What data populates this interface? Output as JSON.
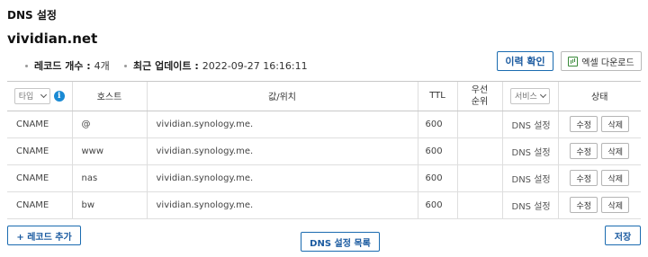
{
  "header": {
    "title": "DNS 설정"
  },
  "domain": {
    "name": "vividian.net"
  },
  "meta": {
    "record_count_label": "레코드 개수 :",
    "record_count_value": "4개",
    "updated_label": "최근 업데이트 :",
    "updated_value": "2022-09-27 16:16:11"
  },
  "actions": {
    "history_label": "이력 확인",
    "excel_label": "엑셀 다운로드"
  },
  "table": {
    "type_select": "타입",
    "info_icon": "i",
    "columns": {
      "host": "호스트",
      "value": "값/위치",
      "ttl": "TTL",
      "priority_line1": "우선",
      "priority_line2": "순위",
      "service_select": "서비스",
      "status": "상태"
    },
    "rows": [
      {
        "type": "CNAME",
        "host": "@",
        "value": "vividian.synology.me.",
        "ttl": "600",
        "priority": "",
        "service": "DNS 설정",
        "edit": "수정",
        "delete": "삭제"
      },
      {
        "type": "CNAME",
        "host": "www",
        "value": "vividian.synology.me.",
        "ttl": "600",
        "priority": "",
        "service": "DNS 설정",
        "edit": "수정",
        "delete": "삭제"
      },
      {
        "type": "CNAME",
        "host": "nas",
        "value": "vividian.synology.me.",
        "ttl": "600",
        "priority": "",
        "service": "DNS 설정",
        "edit": "수정",
        "delete": "삭제"
      },
      {
        "type": "CNAME",
        "host": "bw",
        "value": "vividian.synology.me.",
        "ttl": "600",
        "priority": "",
        "service": "DNS 설정",
        "edit": "수정",
        "delete": "삭제"
      }
    ]
  },
  "footer": {
    "add_label": "+ 레코드 추가",
    "list_label": "DNS 설정 목록",
    "save_label": "저장"
  },
  "colors": {
    "accent": "#1a6bb0",
    "info": "#1a8ad4",
    "excel": "#3a8a3a"
  },
  "icons": {
    "excel": "spreadsheet-icon",
    "info": "info-icon",
    "dropdown": "chevron-down-icon"
  }
}
